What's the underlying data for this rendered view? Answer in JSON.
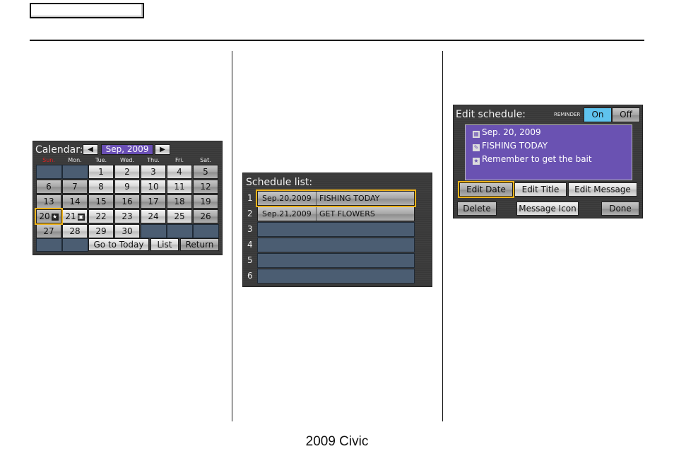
{
  "page": {
    "header_tab_label": "",
    "footer": "2009  Civic"
  },
  "calendar": {
    "title": "Calendar:",
    "prev_icon": "◀",
    "next_icon": "▶",
    "month": "Sep, 2009",
    "weekdays": [
      "Sun.",
      "Mon.",
      "Tue.",
      "Wed.",
      "Thu.",
      "Fri.",
      "Sat."
    ],
    "weeks": [
      [
        "",
        "",
        "1",
        "2",
        "3",
        "4",
        "5"
      ],
      [
        "6",
        "7",
        "8",
        "9",
        "10",
        "11",
        "12"
      ],
      [
        "13",
        "14",
        "15",
        "16",
        "17",
        "18",
        "19"
      ],
      [
        "20",
        "21",
        "22",
        "23",
        "24",
        "25",
        "26"
      ],
      [
        "27",
        "28",
        "29",
        "30",
        "",
        "",
        ""
      ]
    ],
    "selected_day": "20",
    "day_icons": {
      "20": "star-icon",
      "21": "person-icon"
    },
    "buttons": {
      "go_to_today": "Go to Today",
      "list": "List",
      "return": "Return"
    }
  },
  "schedule_list": {
    "title": "Schedule list:",
    "rows": [
      {
        "num": "1",
        "date": "Sep.20,2009",
        "title": "FISHING TODAY",
        "selected": true
      },
      {
        "num": "2",
        "date": "Sep.21,2009",
        "title": "GET FLOWERS",
        "selected": false
      },
      {
        "num": "3",
        "date": "",
        "title": "",
        "selected": false
      },
      {
        "num": "4",
        "date": "",
        "title": "",
        "selected": false
      },
      {
        "num": "5",
        "date": "",
        "title": "",
        "selected": false
      },
      {
        "num": "6",
        "date": "",
        "title": "",
        "selected": false
      }
    ]
  },
  "edit_schedule": {
    "title": "Edit schedule:",
    "reminder_label": "REMINDER",
    "reminder_on": "On",
    "reminder_off": "Off",
    "reminder_state": "On",
    "date": "Sep. 20, 2009",
    "event_title": "FISHING TODAY",
    "message": "Remember to get the bait",
    "buttons": {
      "edit_date": "Edit Date",
      "edit_title": "Edit Title",
      "edit_message": "Edit Message",
      "delete": "Delete",
      "message_icon": "Message Icon",
      "done": "Done"
    }
  },
  "colors": {
    "highlight": "#f0b41a",
    "month_bg": "#6a4fb5",
    "sunday_label": "#e02020",
    "reminder_on_bg": "#5fc3ee",
    "message_panel": "#6a52b2",
    "empty_cell": "#4b5d72"
  }
}
